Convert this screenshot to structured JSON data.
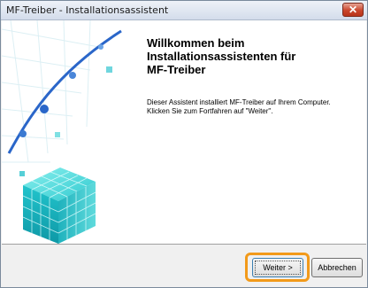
{
  "window": {
    "title": "MF-Treiber - Installationsassistent",
    "close_symbol": "✕"
  },
  "welcome": {
    "heading_lines": [
      "Willkommen beim",
      "Installationsassistenten für",
      "MF-Treiber"
    ],
    "body_lines": [
      "Dieser Assistent installiert MF-Treiber auf Ihrem Computer.",
      "Klicken Sie zum Fortfahren auf \"Weiter\"."
    ]
  },
  "buttons": {
    "next_label": "Weiter >",
    "cancel_label": "Abbrechen"
  },
  "colors": {
    "highlight": "#f29a1a",
    "cube": "#1ec6c9",
    "curve": "#2a66c9"
  },
  "icons": [
    "close-icon",
    "cube-illustration"
  ]
}
